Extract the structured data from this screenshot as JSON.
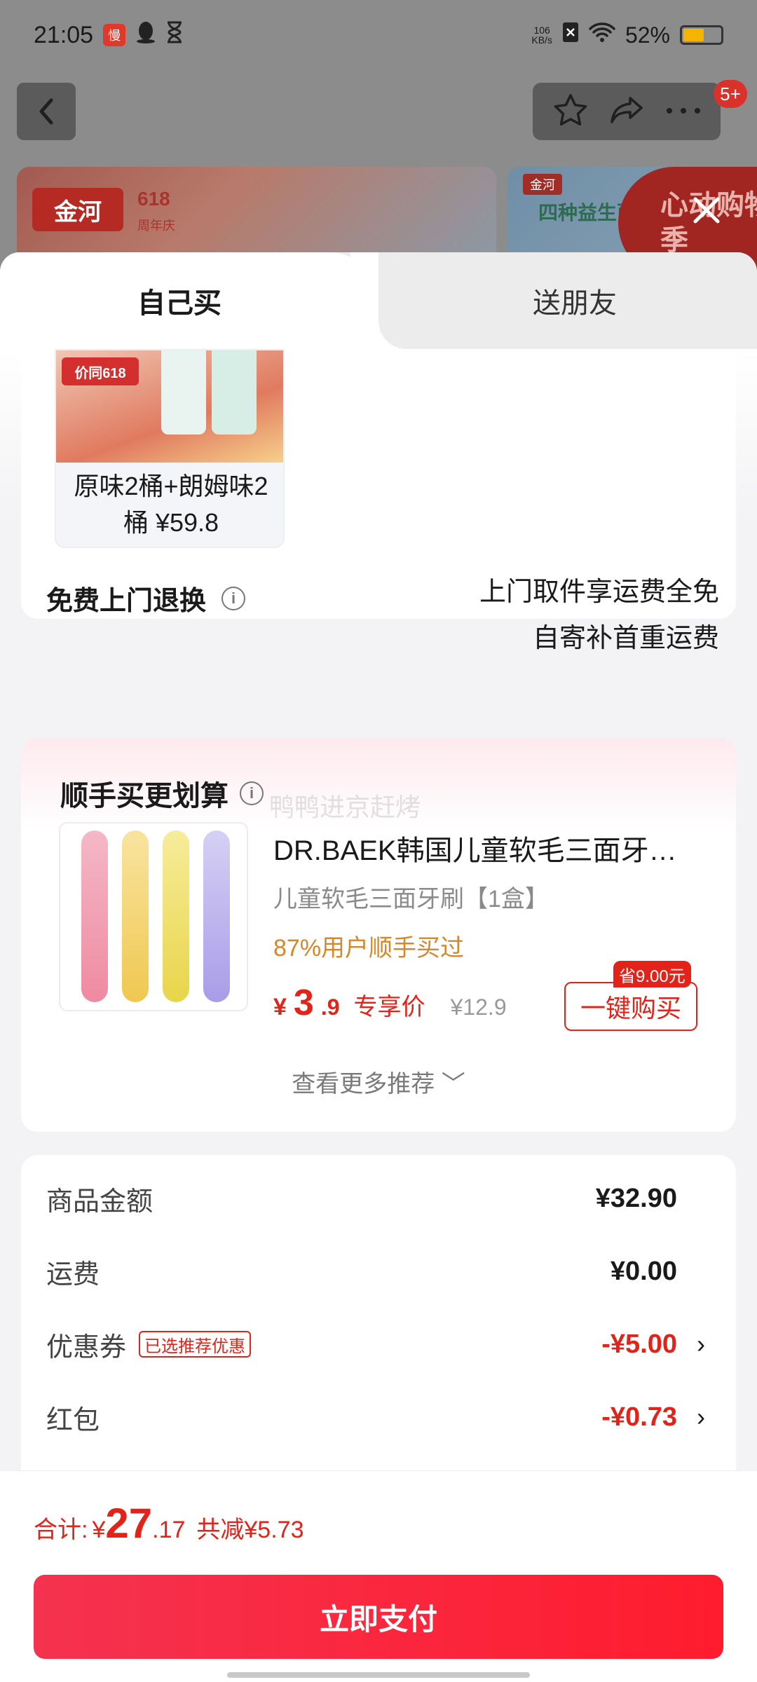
{
  "status_bar": {
    "time": "21:05",
    "net_speed_value": "106",
    "net_speed_unit": "KB/s",
    "battery": "52%",
    "battery_level": 0.52
  },
  "header": {
    "notification_count": "5+"
  },
  "background_banners": {
    "left_brand": "金河",
    "left_tagline": "618",
    "left_sub": "周年庆",
    "right_brand": "金河",
    "right_sub": "四种益生菌",
    "right_promo": "心动购物季"
  },
  "tabs": {
    "self": "自己买",
    "gift": "送朋友"
  },
  "product_option": {
    "tag": "价同618",
    "caption": "原味2桶+朗姆味2桶 ¥59.8"
  },
  "return_service": {
    "label": "免费上门退换",
    "line1": "上门取件享运费全免",
    "line2": "自寄补首重运费"
  },
  "upsell": {
    "title": "顺手买更划算",
    "watermark": "鸭鸭进京赶烤",
    "product_name": "DR.BAEK韩国儿童软毛三面牙…",
    "spec": "儿童软毛三面牙刷【1盒】",
    "social_proof": "87%用户顺手买过",
    "price_symbol": "¥",
    "price_int": "3",
    "price_dec": ".9",
    "price_label": "专享价",
    "price_original": "¥12.9",
    "save_badge": "省9.00元",
    "buy_button": "一键购买",
    "more": "查看更多推荐 ﹀"
  },
  "fees": {
    "goods_label": "商品金额",
    "goods_value": "¥32.90",
    "shipping_label": "运费",
    "shipping_value": "¥0.00",
    "coupon_label": "优惠券",
    "coupon_tag": "已选推荐优惠",
    "coupon_value": "-¥5.00",
    "redpacket_label": "红包",
    "redpacket_value": "-¥0.73"
  },
  "footer": {
    "total_label": "合计:",
    "total_symbol": "¥",
    "total_int": "27",
    "total_dec": ".17",
    "total_saved": "共减¥5.73",
    "pay_button": "立即支付"
  },
  "colors": {
    "accent": "#e2231a",
    "social_proof": "#d4882a"
  }
}
